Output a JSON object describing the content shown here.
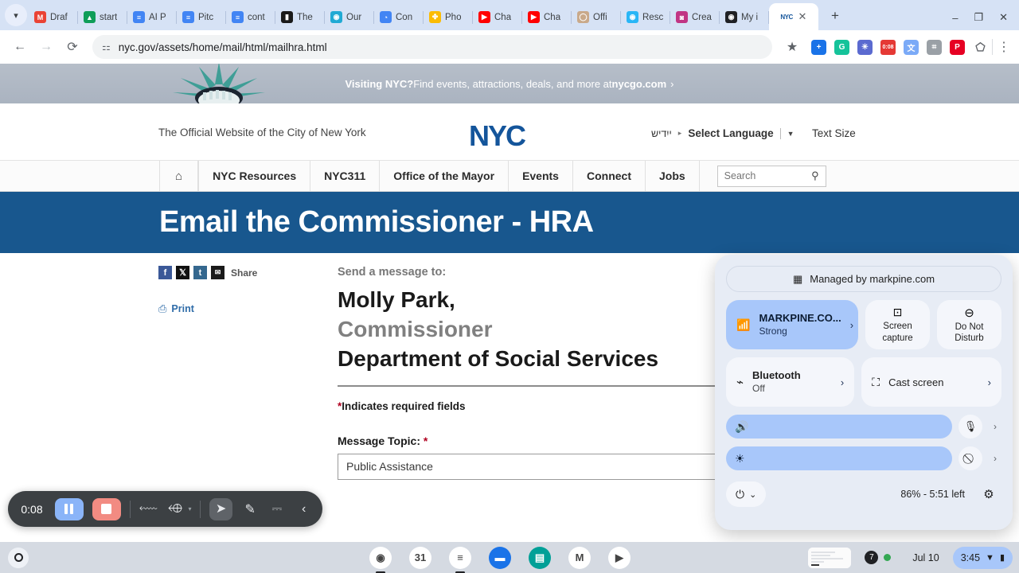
{
  "browser": {
    "tabs": [
      {
        "label": "Draf",
        "icon": "gmail-icon",
        "color": "#ea4335",
        "glyph": "M"
      },
      {
        "label": "start",
        "icon": "google-drive-icon",
        "color": "#0f9d58",
        "glyph": "▲"
      },
      {
        "label": "AI P",
        "icon": "google-docs-icon",
        "color": "#4285f4",
        "glyph": "≡"
      },
      {
        "label": "Pitc",
        "icon": "google-docs-icon",
        "color": "#4285f4",
        "glyph": "≡"
      },
      {
        "label": "cont",
        "icon": "google-docs-icon",
        "color": "#4285f4",
        "glyph": "≡"
      },
      {
        "label": "The",
        "icon": "book-icon",
        "color": "#1a1a1a",
        "glyph": "▮"
      },
      {
        "label": "Our",
        "icon": "circle-icon",
        "color": "#21aad4",
        "glyph": "◉"
      },
      {
        "label": "Con",
        "icon": "clock-icon",
        "color": "#4285f4",
        "glyph": "◔"
      },
      {
        "label": "Pho",
        "icon": "google-photos-icon",
        "color": "#fbbc04",
        "glyph": "✤"
      },
      {
        "label": "Cha",
        "icon": "youtube-icon",
        "color": "#ff0000",
        "glyph": "▶"
      },
      {
        "label": "Cha",
        "icon": "youtube-icon",
        "color": "#ff0000",
        "glyph": "▶"
      },
      {
        "label": "Offi",
        "icon": "avatar-icon",
        "color": "#c9a98a",
        "glyph": "◯"
      },
      {
        "label": "Resc",
        "icon": "fingerprint-icon",
        "color": "#29b6f6",
        "glyph": "◉"
      },
      {
        "label": "Crea",
        "icon": "instagram-icon",
        "color": "#c13584",
        "glyph": "◙"
      },
      {
        "label": "My i",
        "icon": "color-wheel-icon",
        "color": "#202124",
        "glyph": "◉"
      }
    ],
    "active_tab": {
      "label": "NYC",
      "icon": "nyc-favicon"
    },
    "tab_close_label": "✕",
    "new_tab_label": "+",
    "window_controls": {
      "minimize": "–",
      "maximize": "❐",
      "close": "✕"
    },
    "nav": {
      "back": "←",
      "forward": "→",
      "reload": "⟳"
    },
    "omnibox": {
      "site_settings_icon": "tune-icon",
      "url": "nyc.gov/assets/home/mail/html/mailhra.html",
      "star_icon": "★"
    },
    "extensions": [
      {
        "name": "add-extension-icon",
        "color": "#1a73e8",
        "glyph": "+"
      },
      {
        "name": "grammarly-icon",
        "color": "#15c39a",
        "glyph": "G"
      },
      {
        "name": "settings-star-icon",
        "color": "#5b6ad0",
        "glyph": "✳"
      },
      {
        "name": "screen-recorder-icon",
        "color": "#e53935",
        "glyph": "0:08"
      },
      {
        "name": "translate-icon",
        "color": "#7baaf7",
        "glyph": "文"
      },
      {
        "name": "puzzle-gray-icon",
        "color": "#9aa0a6",
        "glyph": "⌗"
      },
      {
        "name": "pinterest-icon",
        "color": "#e60023",
        "glyph": "P"
      },
      {
        "name": "extensions-icon",
        "color": "#ffffff",
        "glyph": "⬠"
      }
    ],
    "menu_icon": "⋮"
  },
  "site": {
    "nycgo_banner": {
      "bold_prefix": "Visiting NYC?",
      "text": " Find events, attractions, deals, and more at ",
      "link": "nycgo.com",
      "arrow": "›"
    },
    "official_tagline": "The Official Website of the City of New York",
    "logo_text": "NYC",
    "language": {
      "native": "ייִדיש",
      "arrow": "▸",
      "select_label": "Select Language",
      "caret": "▼"
    },
    "text_size_label": "Text Size",
    "nav_items": [
      "NYC Resources",
      "NYC311",
      "Office of the Mayor",
      "Events",
      "Connect",
      "Jobs"
    ],
    "home_icon": "⌂",
    "search": {
      "placeholder": "Search",
      "icon": "search-icon",
      "glyph": "⚲"
    },
    "hero_title": "Email the Commissioner - HRA",
    "share": {
      "label": "Share",
      "buttons": [
        {
          "name": "facebook-share-button",
          "glyph": "f"
        },
        {
          "name": "x-share-button",
          "glyph": "𝕏"
        },
        {
          "name": "tumblr-share-button",
          "glyph": "t"
        },
        {
          "name": "email-share-button",
          "glyph": "✉"
        }
      ]
    },
    "print": {
      "label": "Print",
      "icon": "printer-icon",
      "glyph": "⎙"
    },
    "form": {
      "send_to_label": "Send a message to:",
      "recipient_name": "Molly Park,",
      "recipient_title": "Commissioner",
      "recipient_dept": "Department of Social Services",
      "required_note": "Indicates required fields",
      "asterisk": "*",
      "message_topic_label": "Message Topic:",
      "message_topic_value": "Public Assistance"
    }
  },
  "recording_toolbar": {
    "time": "0:08",
    "pause_label": "pause-button",
    "stop_label": "stop-button",
    "camera_off_icon": "◙",
    "mic_off_icon": "🎤",
    "caret": "▾",
    "cursor_icon": "➤",
    "pen_icon": "✎",
    "eraser_icon": "⌨",
    "collapse_icon": "‹"
  },
  "quick_settings": {
    "managed_text": "Managed by markpine.com",
    "managed_icon": "building-icon",
    "wifi": {
      "name": "MARKPINE.CO...",
      "status": "Strong",
      "icon": "wifi-lock-icon",
      "chevron": "›"
    },
    "screen_capture": {
      "line1": "Screen",
      "line2": "capture",
      "icon": "screen-capture-icon"
    },
    "do_not_disturb": {
      "line1": "Do Not",
      "line2": "Disturb",
      "icon": "do-not-disturb-icon"
    },
    "bluetooth": {
      "name": "Bluetooth",
      "status": "Off",
      "icon": "bluetooth-off-icon",
      "chevron": "›"
    },
    "cast": {
      "label": "Cast screen",
      "icon": "cast-icon",
      "chevron": "›"
    },
    "volume_icon": "🔊",
    "brightness_icon": "☀",
    "mic_muted_icon": "mic-muted-icon",
    "camera_blocked_icon": "camera-blocked-icon",
    "slider_chevron": "›",
    "power_icon": "⏻",
    "power_caret": "⌄",
    "battery_text": "86% - 5:51 left",
    "settings_icon": "⚙"
  },
  "shelf": {
    "launcher_icon": "launcher-icon",
    "apps": [
      {
        "name": "chrome-icon",
        "glyph": "◉",
        "color": "#ffffff",
        "active": true
      },
      {
        "name": "google-calendar-icon",
        "glyph": "31",
        "color": "#ffffff",
        "active": false
      },
      {
        "name": "google-docs-icon",
        "glyph": "≡",
        "color": "#ffffff",
        "active": true
      },
      {
        "name": "files-icon",
        "glyph": "▬",
        "color": "#1a73e8",
        "active": false
      },
      {
        "name": "google-keep-icon",
        "glyph": "▤",
        "color": "#00a097",
        "active": false
      },
      {
        "name": "gmail-icon",
        "glyph": "M",
        "color": "#ffffff",
        "active": false
      },
      {
        "name": "youtube-icon",
        "glyph": "▶",
        "color": "#ffffff",
        "active": false
      }
    ],
    "status": {
      "notification_count": "7",
      "date": "Jul 10",
      "time": "3:45",
      "wifi_icon": "▼",
      "battery_icon": "▮"
    }
  }
}
